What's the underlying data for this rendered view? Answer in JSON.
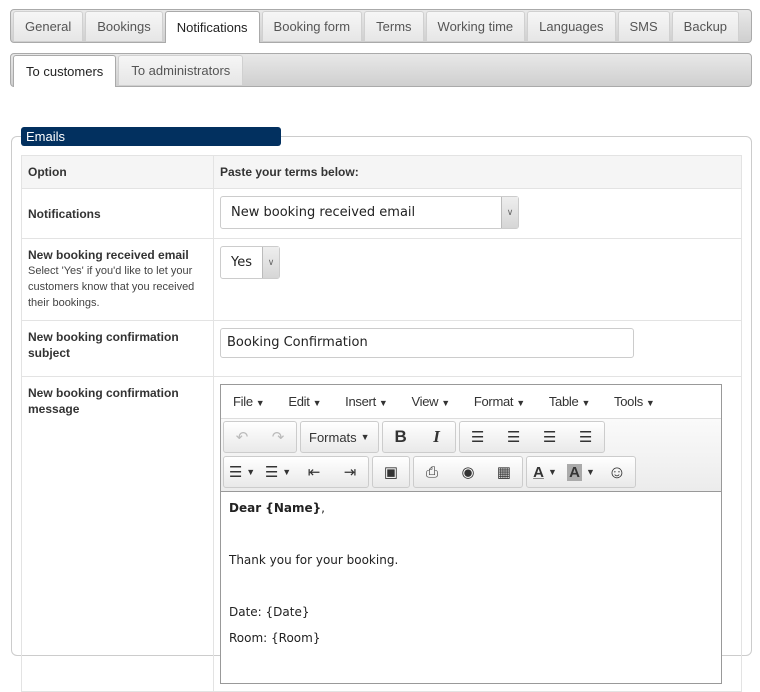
{
  "main_tabs": [
    {
      "label": "General",
      "active": false
    },
    {
      "label": "Bookings",
      "active": false
    },
    {
      "label": "Notifications",
      "active": true
    },
    {
      "label": "Booking form",
      "active": false
    },
    {
      "label": "Terms",
      "active": false
    },
    {
      "label": "Working time",
      "active": false
    },
    {
      "label": "Languages",
      "active": false
    },
    {
      "label": "SMS",
      "active": false
    },
    {
      "label": "Backup",
      "active": false
    }
  ],
  "sub_tabs": [
    {
      "label": "To customers",
      "active": true
    },
    {
      "label": "To administrators",
      "active": false
    }
  ],
  "section": {
    "legend": "Emails"
  },
  "table": {
    "header": {
      "option": "Option",
      "value": "Paste your terms below:"
    },
    "rows": {
      "notifications": {
        "label": "Notifications",
        "selected": "New booking received email"
      },
      "received_email": {
        "label": "New booking received email",
        "help": "Select 'Yes' if you'd like to let your customers know that you received their bookings.",
        "selected": "Yes"
      },
      "subject": {
        "label": "New booking confirmation subject",
        "value": "Booking Confirmation"
      },
      "message": {
        "label": "New booking confirmation message"
      }
    }
  },
  "editor": {
    "menus": [
      "File",
      "Edit",
      "Insert",
      "View",
      "Format",
      "Table",
      "Tools"
    ],
    "toolbar": {
      "undo": "↶",
      "redo": "↷",
      "formats_label": "Formats",
      "bold": "B",
      "italic": "I",
      "align_left": "☰",
      "align_center": "☰",
      "align_right": "☰",
      "justify": "☰",
      "bullet_list": "☰",
      "numbered_list": "☰",
      "outdent": "⇤",
      "indent": "⇥",
      "image": "▣",
      "print": "⎙",
      "preview": "◉",
      "media": "▦",
      "text_color": "A",
      "bg_color": "A",
      "emoticons": "☺"
    },
    "content": {
      "greeting_bold": "Dear {Name}",
      "greeting_end": ",",
      "line1": "Thank you for your booking.",
      "line2": "Date: {Date}",
      "line3": "Room: {Room}"
    }
  }
}
